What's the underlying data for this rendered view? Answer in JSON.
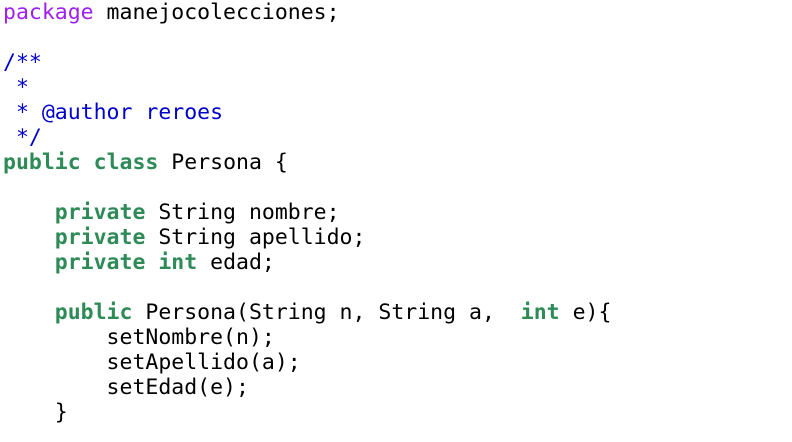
{
  "editor": {
    "lines": [
      [
        {
          "t": "package",
          "k": "pkg"
        },
        {
          "t": " manejocolecciones;",
          "k": "plain"
        }
      ],
      [],
      [
        {
          "t": "/**",
          "k": "comment"
        }
      ],
      [
        {
          "t": " *",
          "k": "comment"
        }
      ],
      [
        {
          "t": " * @author reroes",
          "k": "comment"
        }
      ],
      [
        {
          "t": " */",
          "k": "comment"
        }
      ],
      [
        {
          "t": "public",
          "k": "kw"
        },
        {
          "t": " ",
          "k": "plain"
        },
        {
          "t": "class",
          "k": "kw"
        },
        {
          "t": " Persona {",
          "k": "plain"
        }
      ],
      [],
      [
        {
          "t": "    ",
          "k": "plain"
        },
        {
          "t": "private",
          "k": "kw"
        },
        {
          "t": " String nombre;",
          "k": "plain"
        }
      ],
      [
        {
          "t": "    ",
          "k": "plain"
        },
        {
          "t": "private",
          "k": "kw"
        },
        {
          "t": " String apellido;",
          "k": "plain"
        }
      ],
      [
        {
          "t": "    ",
          "k": "plain"
        },
        {
          "t": "private",
          "k": "kw"
        },
        {
          "t": " ",
          "k": "plain"
        },
        {
          "t": "int",
          "k": "kw"
        },
        {
          "t": " edad;",
          "k": "plain"
        }
      ],
      [],
      [
        {
          "t": "    ",
          "k": "plain"
        },
        {
          "t": "public",
          "k": "kw"
        },
        {
          "t": " Persona(String n, String a,  ",
          "k": "plain"
        },
        {
          "t": "int",
          "k": "kw"
        },
        {
          "t": " e){",
          "k": "plain"
        }
      ],
      [
        {
          "t": "        setNombre(n);",
          "k": "plain"
        }
      ],
      [
        {
          "t": "        setApellido(a);",
          "k": "plain"
        }
      ],
      [
        {
          "t": "        setEdad(e);",
          "k": "plain"
        }
      ],
      [
        {
          "t": "    }",
          "k": "plain"
        }
      ]
    ]
  }
}
